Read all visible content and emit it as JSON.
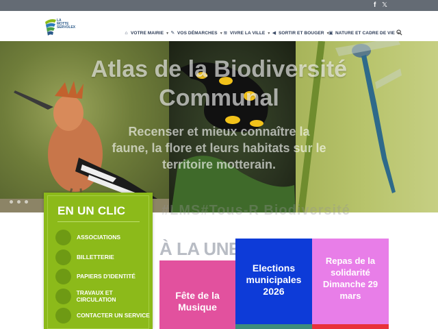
{
  "social": {
    "facebook": "f",
    "x": "𝕏"
  },
  "logo": {
    "text": "LA MOTTE SERVOLEX"
  },
  "nav": {
    "items": [
      {
        "label": "VOTRE MAIRIE",
        "icon": "city-hall-icon"
      },
      {
        "label": "VOS DÉMARCHES",
        "icon": "pen-icon"
      },
      {
        "label": "VIVRE LA VILLE",
        "icon": "signal-icon"
      },
      {
        "label": "SORTIR ET BOUGER",
        "icon": "megaphone-icon"
      },
      {
        "label": "NATURE ET CADRE DE VIE",
        "icon": "image-icon"
      }
    ]
  },
  "hero": {
    "title": "Atlas de la Biodiversité Communal",
    "subtitle": "Recenser et mieux connaître la faune, la flore et leurs habitats sur le territoire motterain.",
    "ghost": "#LMS#Tous-R Biodiversité"
  },
  "clic": {
    "title": "EN UN CLIC",
    "items": [
      {
        "label": "ASSOCIATIONS"
      },
      {
        "label": "BILLETTERIE"
      },
      {
        "label": "PAPIERS D'IDENTITÉ"
      },
      {
        "label": "TRAVAUX ET CIRCULATION"
      },
      {
        "label": "CONTACTER UN SERVICE"
      }
    ]
  },
  "une": {
    "heading": "À LA UNE",
    "cards": [
      {
        "title": "Fête de la Musique"
      },
      {
        "title": "Elections municipales 2026"
      },
      {
        "title": "Repas de la solidarité Dimanche 29 mars"
      }
    ]
  },
  "colors": {
    "topbar": "#646b74",
    "clic_green": "#8cba1a",
    "card_pink": "#e2519e",
    "card_blue": "#0d3bd8",
    "card_violet": "#e87ee8"
  }
}
